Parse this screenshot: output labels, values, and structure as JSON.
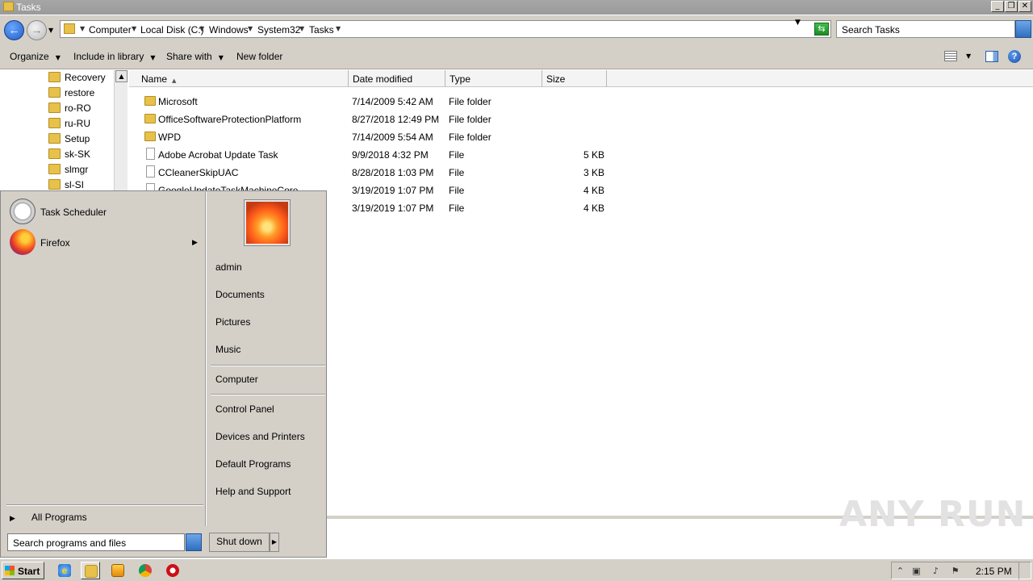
{
  "window": {
    "title": "Tasks"
  },
  "address": {
    "crumbs": [
      "Computer",
      "Local Disk (C:)",
      "Windows",
      "System32",
      "Tasks"
    ],
    "search_placeholder": "Search Tasks"
  },
  "toolbar": {
    "organize": "Organize",
    "include_in_library": "Include in library",
    "share_with": "Share with",
    "new_folder": "New folder"
  },
  "nav": {
    "items": [
      "Recovery",
      "restore",
      "ro-RO",
      "ru-RU",
      "Setup",
      "sk-SK",
      "slmgr",
      "sl-SI"
    ]
  },
  "columns": {
    "name": "Name",
    "date": "Date modified",
    "type": "Type",
    "size": "Size"
  },
  "files": [
    {
      "name": "Microsoft",
      "date": "7/14/2009 5:42 AM",
      "type": "File folder",
      "size": "",
      "icon": "folder-icon"
    },
    {
      "name": "OfficeSoftwareProtectionPlatform",
      "date": "8/27/2018 12:49 PM",
      "type": "File folder",
      "size": "",
      "icon": "folder-icon"
    },
    {
      "name": "WPD",
      "date": "7/14/2009 5:54 AM",
      "type": "File folder",
      "size": "",
      "icon": "folder-icon"
    },
    {
      "name": "Adobe Acrobat Update Task",
      "date": "9/9/2018 4:32 PM",
      "type": "File",
      "size": "5 KB",
      "icon": "file-icon"
    },
    {
      "name": "CCleanerSkipUAC",
      "date": "8/28/2018 1:03 PM",
      "type": "File",
      "size": "3 KB",
      "icon": "file-icon"
    },
    {
      "name": "GoogleUpdateTaskMachineCore",
      "date": "3/19/2019 1:07 PM",
      "type": "File",
      "size": "4 KB",
      "icon": "file-icon"
    },
    {
      "name": "",
      "date": "3/19/2019 1:07 PM",
      "type": "File",
      "size": "4 KB",
      "icon": "file-icon"
    }
  ],
  "start_menu": {
    "programs": [
      {
        "label": "Task Scheduler",
        "icon": "clock-icon"
      },
      {
        "label": "Firefox",
        "icon": "firefox-icon"
      }
    ],
    "all_programs": "All Programs",
    "search_placeholder": "Search programs and files",
    "right_links": [
      "admin",
      "Documents",
      "Pictures",
      "Music",
      "Computer",
      "Control Panel",
      "Devices and Printers",
      "Default Programs",
      "Help and Support"
    ],
    "shutdown": "Shut down"
  },
  "taskbar": {
    "start": "Start",
    "clock": "2:15 PM",
    "apps": [
      "internet-explorer-icon",
      "explorer-icon",
      "media-player-icon",
      "chrome-icon",
      "opera-icon"
    ]
  },
  "watermark": "ANY RUN"
}
